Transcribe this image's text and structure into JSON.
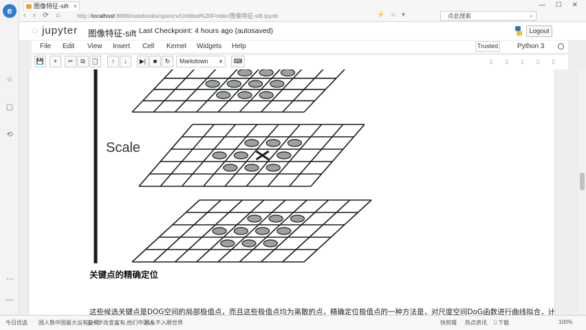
{
  "browser": {
    "logo_letter": "e",
    "tab_title": "图像特征-sift",
    "tab_close": "×",
    "nav": "‹ › ⟳ ⌂",
    "url_prefix": "http://",
    "url_host": "localhost",
    "url_rest": ":8888/notebooks/opencv/Untitled%20Folder/图像特征-sift.ipynb",
    "url_tools": "⚡ ☆ ▾",
    "search_text": "点此搜索",
    "window_buttons": "— ☐ ✕",
    "side_buttons": [
      "☆",
      "▢",
      "⟲",
      "⋯",
      "—"
    ]
  },
  "jupyter": {
    "logo_text": "jupyter",
    "notebook_title": "图像特征-sift",
    "checkpoint": "Last Checkpoint: 4 hours ago (autosaved)",
    "logout": "Logout",
    "menu": [
      "File",
      "Edit",
      "View",
      "Insert",
      "Cell",
      "Kernel",
      "Widgets",
      "Help"
    ],
    "trusted": "Trusted",
    "kernel_name": "Python 3",
    "toolbar": {
      "buttons": [
        {
          "name": "save-button",
          "icon": "💾"
        },
        {
          "name": "insert-cell-button",
          "icon": "+"
        },
        {
          "name": "cut-button",
          "icon": "✂"
        },
        {
          "name": "copy-button",
          "icon": "⧉"
        },
        {
          "name": "paste-button",
          "icon": "📋"
        },
        {
          "name": "move-up-button",
          "icon": "↑"
        },
        {
          "name": "move-down-button",
          "icon": "↓"
        },
        {
          "name": "run-button",
          "icon": "▶|"
        },
        {
          "name": "interrupt-button",
          "icon": "■"
        },
        {
          "name": "restart-button",
          "icon": "↻"
        }
      ],
      "cell_type": "Markdown",
      "keyboard_icon": "⌨"
    }
  },
  "content": {
    "figure_label": "Scale",
    "heading": "关键点的精确定位",
    "paragraph": "这些候选关键点是DOG空间的局部极值点，而且这些极值点均为离散的点，精确定位极值点的一种方法是，对尺度空间DoG函数进行曲线拟合，计算其极值点"
  },
  "statusbar": {
    "items": [
      "今日优选",
      "国人数中国最大没有获得",
      "五十岁改变富有,他们中国人",
      "恐永不入眼世界",
      "快剪辑",
      "热点资讯",
      "⇩下载",
      "100%"
    ]
  },
  "colors": {
    "jupyter_orange": "#f37726",
    "ellipse_fill": "#9aa39a",
    "grid_stroke": "#1a1a1a"
  }
}
